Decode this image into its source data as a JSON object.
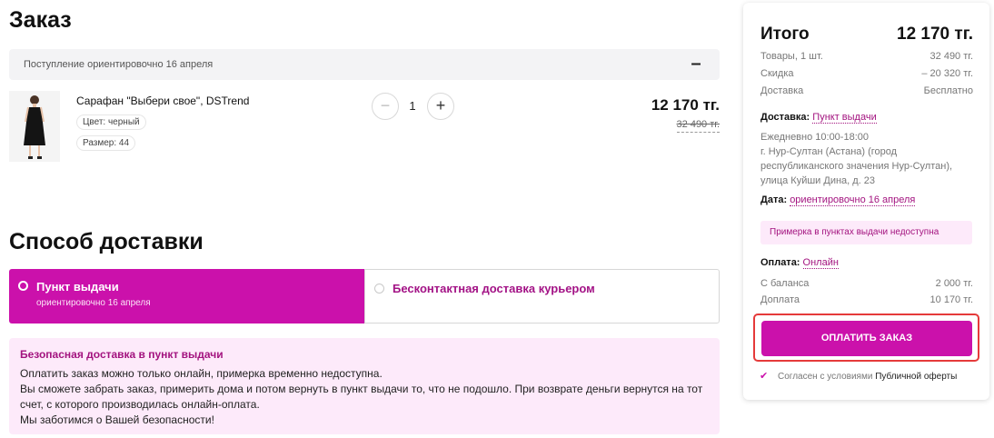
{
  "order": {
    "title": "Заказ",
    "arrival": "Поступление ориентировочно 16 апреля",
    "collapse": "–",
    "product": {
      "name": "Сарафан \"Выбери свое\", DSTrend",
      "color": "Цвет: черный",
      "size": "Размер: 44",
      "qty_minus": "−",
      "qty": "1",
      "qty_plus": "+",
      "price": "12 170 тг.",
      "old_price": "32 490 тг."
    }
  },
  "delivery": {
    "title": "Способ доставки",
    "options": [
      {
        "label": "Пункт выдачи",
        "sub": "ориентировочно 16 апреля",
        "selected": true
      },
      {
        "label": "Бесконтактная доставка курьером",
        "selected": false
      }
    ],
    "info": {
      "title": "Безопасная доставка в пункт выдачи",
      "lines": [
        "Оплатить заказ можно только онлайн, примерка временно недоступна.",
        "Вы сможете забрать заказ, примерить дома и потом вернуть в пункт выдачи то, что не подошло. При возврате деньги вернутся на тот",
        "счет, с которого производилась онлайн-оплата.",
        "Мы заботимся о Вашей безопасности!"
      ]
    }
  },
  "summary": {
    "total_label": "Итого",
    "total_value": "12 170 тг.",
    "rows": [
      {
        "label": "Товары, 1 шт.",
        "value": "32 490 тг."
      },
      {
        "label": "Скидка",
        "value": "– 20 320 тг."
      },
      {
        "label": "Доставка",
        "value": "Бесплатно"
      }
    ],
    "delivery_label": "Доставка:",
    "delivery_value": "Пункт выдачи",
    "address": [
      "Ежедневно 10:00-18:00",
      "г. Нур-Султан (Астана) (город",
      "республиканского значения Нур-Султан),",
      "улица Куйши Дина, д. 23"
    ],
    "date_label": "Дата:",
    "date_value": "ориентировочно 16 апреля",
    "notice": "Примерка в пунктах выдачи недоступна",
    "payment_label": "Оплата:",
    "payment_value": "Онлайн",
    "payment_rows": [
      {
        "label": "С баланса",
        "value": "2 000 тг."
      },
      {
        "label": "Доплата",
        "value": "10 170 тг."
      }
    ],
    "pay_button": "ОПЛАТИТЬ ЗАКАЗ",
    "agree_check": "✔",
    "agree_text": "Согласен с условиями",
    "agree_link": "Публичной оферты"
  },
  "colors": {
    "accent": "#cb11ab",
    "accent_text": "#a3137f",
    "highlight": "#e53a3a"
  }
}
